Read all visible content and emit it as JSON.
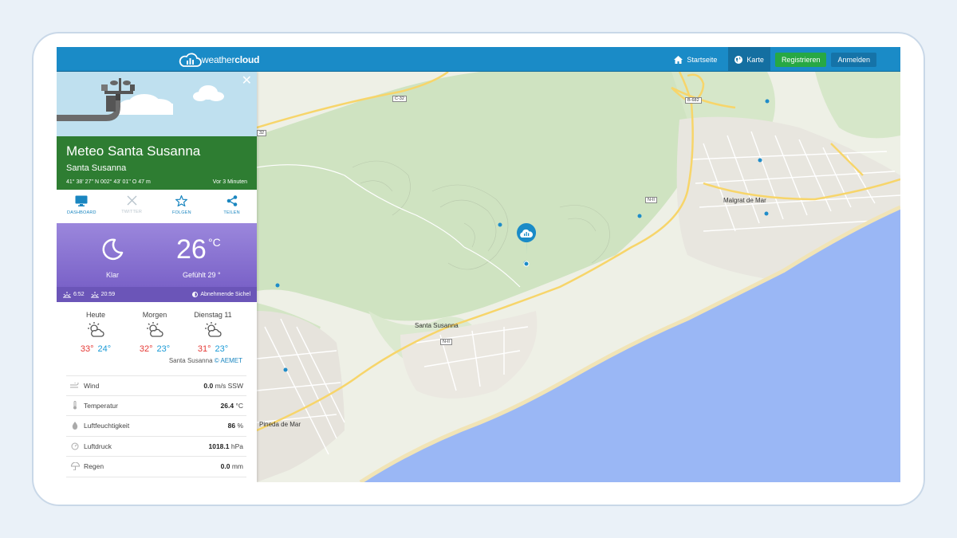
{
  "brand": {
    "text_light": "weather",
    "text_bold": "cloud"
  },
  "nav": {
    "home": "Startseite",
    "map": "Karte",
    "register": "Registrieren",
    "login": "Anmelden"
  },
  "station": {
    "title": "Meteo Santa Susanna",
    "subtitle": "Santa Susanna",
    "coords": "41° 38' 27'' N   002° 43' 01'' O   47 m",
    "updated": "Vor 3 Minuten"
  },
  "actions": [
    {
      "label": "DASHBOARD",
      "icon": "monitor-icon"
    },
    {
      "label": "TWITTER",
      "icon": "x-twitter-icon"
    },
    {
      "label": "FOLGEN",
      "icon": "star-icon"
    },
    {
      "label": "TEILEN",
      "icon": "share-icon"
    }
  ],
  "current": {
    "condition": "Klar",
    "temp": "26",
    "unit": "°C",
    "feels": "Gefühlt 29 °",
    "sunrise": "6:52",
    "sunset": "20:59",
    "moon": "Abnehmende Sichel"
  },
  "forecast": [
    {
      "day": "Heute",
      "hi": "33°",
      "lo": "24°"
    },
    {
      "day": "Morgen",
      "hi": "32°",
      "lo": "23°"
    },
    {
      "day": "Dienstag 11",
      "hi": "31°",
      "lo": "23°"
    }
  ],
  "forecast_source": {
    "text": "Santa Susanna",
    "link": "© AEMET"
  },
  "sensors": [
    {
      "label": "Wind",
      "value": "0.0",
      "unit": "m/s SSW",
      "icon": "wind-icon"
    },
    {
      "label": "Temperatur",
      "value": "26.4",
      "unit": "°C",
      "icon": "thermometer-icon"
    },
    {
      "label": "Luftfeuchtigkeit",
      "value": "86",
      "unit": "%",
      "icon": "droplet-icon"
    },
    {
      "label": "Luftdruck",
      "value": "1018.1",
      "unit": "hPa",
      "icon": "gauge-icon"
    },
    {
      "label": "Regen",
      "value": "0.0",
      "unit": "mm",
      "icon": "umbrella-icon"
    }
  ],
  "map": {
    "places": [
      "Malgrat de Mar",
      "Santa Susanna",
      "Pineda de Mar"
    ],
    "roads": [
      "C-32",
      "B-682",
      "N-II",
      "N-II",
      "32"
    ]
  },
  "colors": {
    "navbar": "#1a8bc7",
    "station_green": "#2e7d32",
    "now_purple": "#8a74d2",
    "sea": "#9ab7f5",
    "accent_blue": "#1a86c0"
  }
}
